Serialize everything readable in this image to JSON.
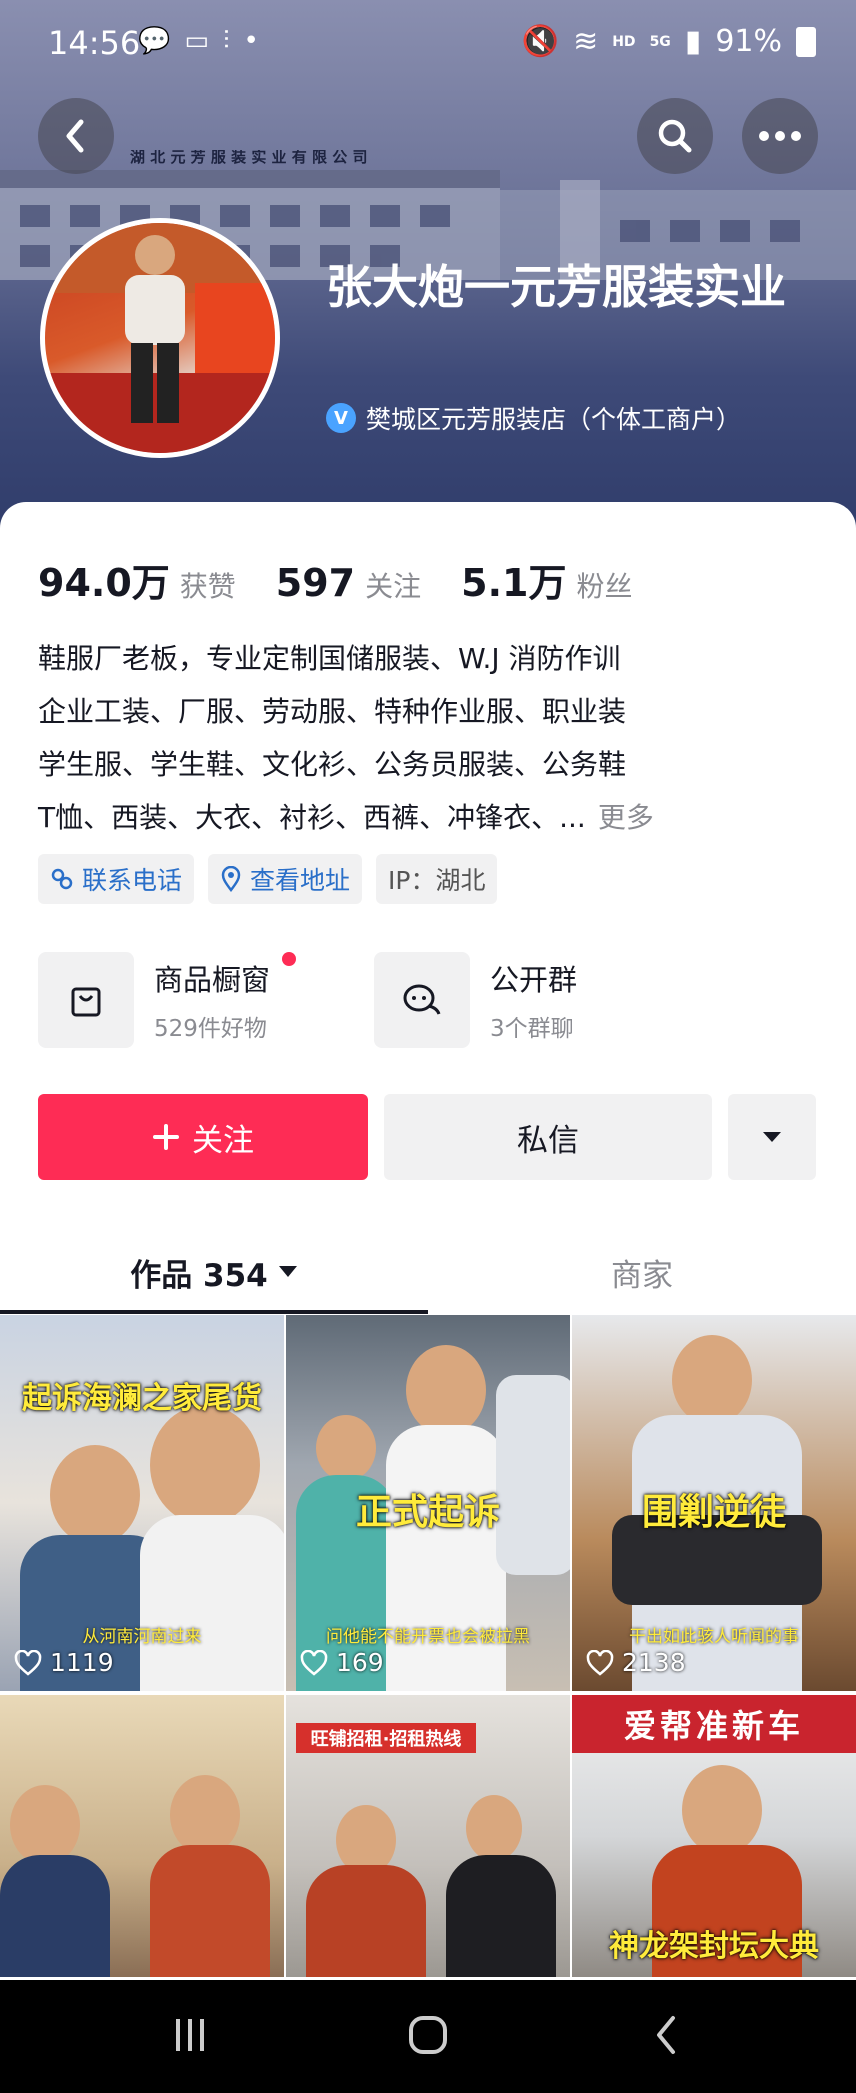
{
  "status_bar": {
    "time": "14:56",
    "network": "HD",
    "signal": "5G",
    "battery": "91%"
  },
  "profile": {
    "name": "张大炮一元芳服装实业",
    "verification": "樊城区元芳服装店（个体工商户）",
    "banner_sign": "湖 北 元 芳 服 装 实 业 有 限 公 司"
  },
  "stats": [
    {
      "value": "94.0万",
      "label": "获赞"
    },
    {
      "value": "597",
      "label": "关注"
    },
    {
      "value": "5.1万",
      "label": "粉丝"
    }
  ],
  "bio": {
    "lines": [
      "鞋服厂老板，专业定制国储服装、W.J 消防作训",
      "企业工装、厂服、劳动服、特种作业服、职业装",
      "学生服、学生鞋、文化衫、公务员服装、公务鞋",
      "T恤、西装、大衣、衬衫、西裤、冲锋衣、..."
    ],
    "more": "更多"
  },
  "tags": {
    "phone": "联系电话",
    "address": "查看地址",
    "ip": "IP：湖北"
  },
  "features": {
    "shop": {
      "title": "商品橱窗",
      "subtitle": "529件好物"
    },
    "group": {
      "title": "公开群",
      "subtitle": "3个群聊"
    }
  },
  "actions": {
    "follow": "关注",
    "message": "私信"
  },
  "tabs": {
    "works": "作品 354",
    "merchant": "商家"
  },
  "videos": [
    {
      "caption": "起诉海澜之家尾货",
      "subtitle": "从河南河南过来",
      "likes": "1119"
    },
    {
      "caption": "正式起诉",
      "subtitle": "问他能不能开票也会被拉黑",
      "likes": "169"
    },
    {
      "caption": "围剿逆徒",
      "subtitle": "干出如此骇人听闻的事",
      "likes": "2138"
    },
    {
      "caption": "",
      "subtitle": "",
      "likes": ""
    },
    {
      "caption": "旺铺招租·招租热线",
      "subtitle": "",
      "likes": ""
    },
    {
      "caption": "神龙架封坛大典",
      "top_caption": "爱帮准新车",
      "subtitle": "",
      "likes": ""
    }
  ],
  "colors": {
    "accent": "#fe2c55",
    "link": "#2a6fc9",
    "caption": "#ffeb3b"
  }
}
